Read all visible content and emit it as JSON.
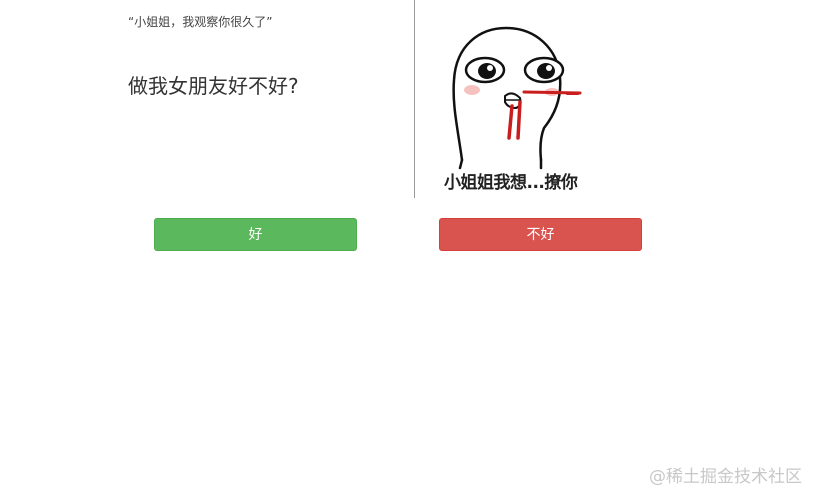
{
  "intro": {
    "quote": "“小姐姐，我观察你很久了”",
    "question": "做我女朋友好不好?"
  },
  "meme": {
    "caption": "小姐姐我想...撩你"
  },
  "buttons": {
    "yes_label": "好",
    "no_label": "不好",
    "yes_color": "#5cb85c",
    "no_color": "#d9534f"
  },
  "watermark": {
    "text": "@稀土掘金技术社区"
  }
}
